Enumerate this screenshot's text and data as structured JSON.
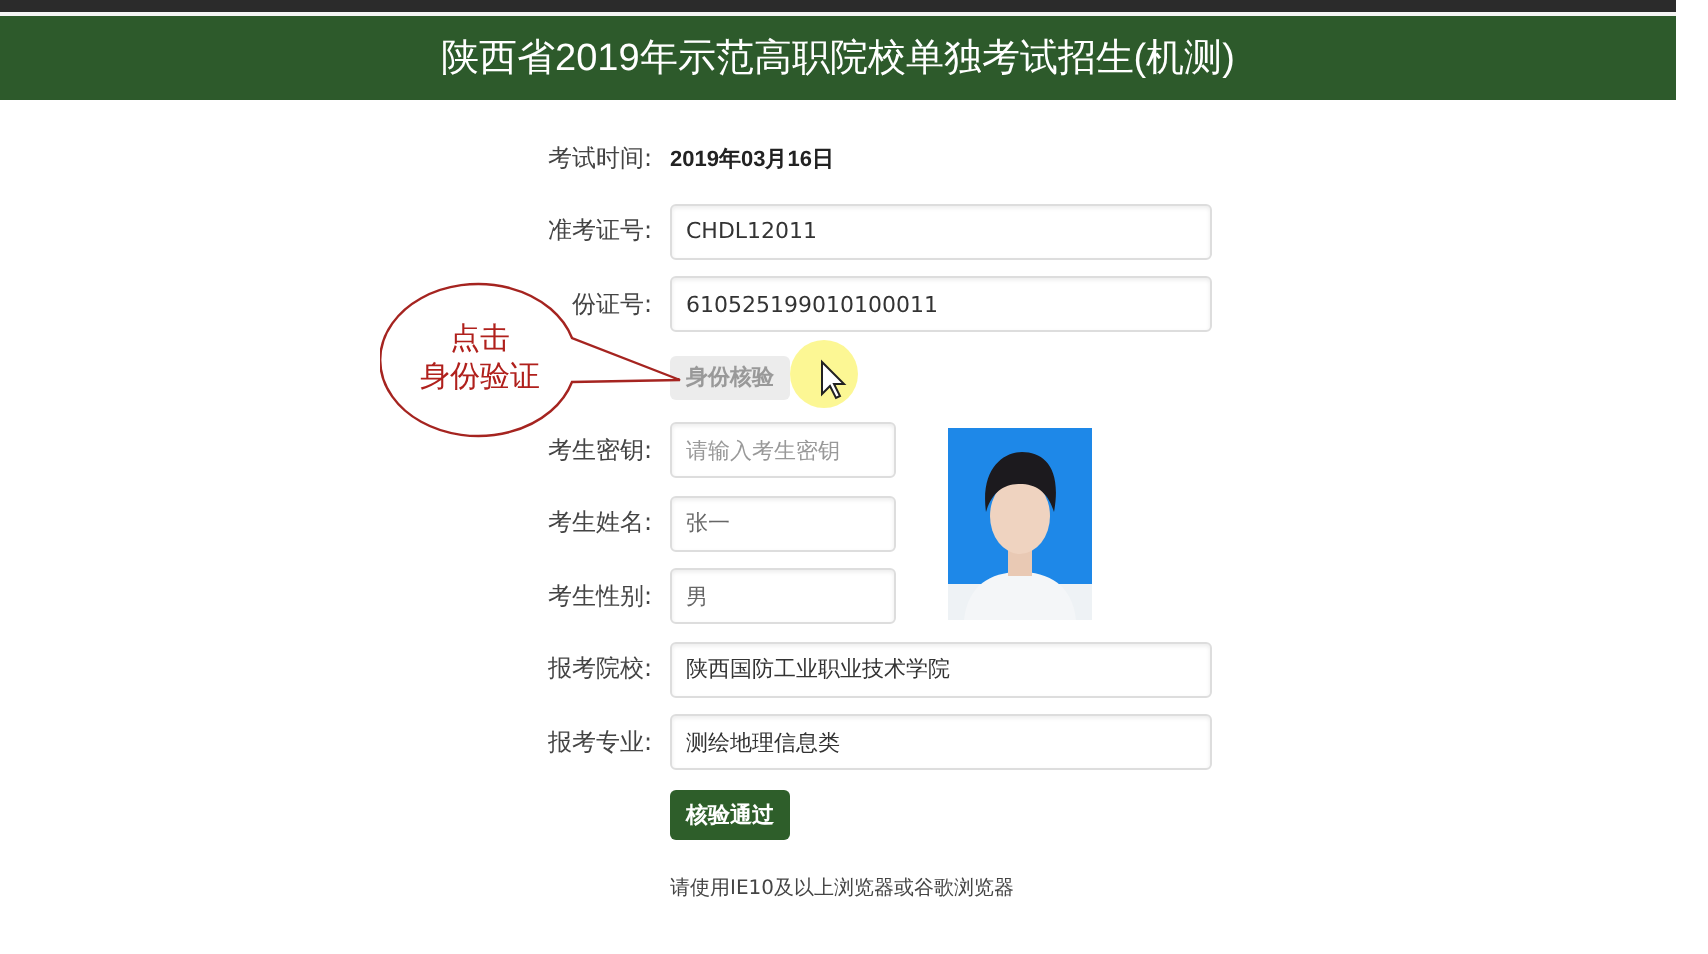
{
  "header": {
    "title": "陕西省2019年示范高职院校单独考试招生(机测)"
  },
  "form": {
    "rows": [
      {
        "kind": "text",
        "label": "考试时间:",
        "value": "2019年03月16日"
      },
      {
        "kind": "input",
        "label": "准考证号:",
        "value": "CHDL12011"
      },
      {
        "kind": "input",
        "label": "份证号:",
        "value": "610525199010100011"
      },
      {
        "kind": "button",
        "label": "身份核验",
        "disabled": true
      },
      {
        "kind": "short_input",
        "label": "考生密钥:",
        "placeholder": "请输入考生密钥"
      },
      {
        "kind": "short_input",
        "label": "考生姓名:",
        "value": "张一"
      },
      {
        "kind": "short_input",
        "label": "考生性别:",
        "value": "男"
      },
      {
        "kind": "input",
        "label": "报考院校:",
        "value": "陕西国防工业职业技术学院"
      },
      {
        "kind": "input",
        "label": "报考专业:",
        "value": "测绘地理信息类"
      },
      {
        "kind": "button",
        "label": "核验通过",
        "disabled": false
      },
      {
        "kind": "note",
        "value": "请使用IE10及以上浏览器或谷歌浏览器"
      }
    ]
  },
  "callout": {
    "lines": [
      "点击",
      "身份验证"
    ]
  }
}
